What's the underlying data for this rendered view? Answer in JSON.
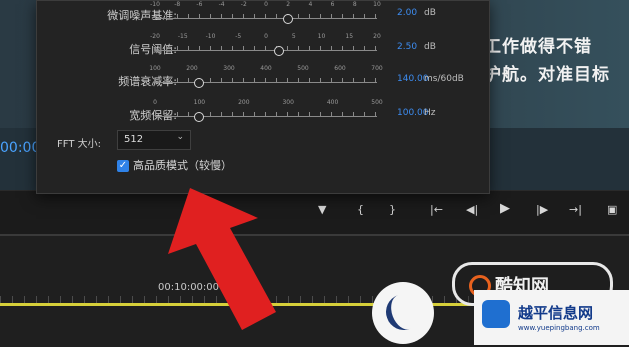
{
  "video": {
    "subtitle_line1": "工作做得不错",
    "subtitle_line2": "护航。对准目标",
    "timecode_left": "00:00"
  },
  "timeline": {
    "ruler_timecode": "00:10:00:00"
  },
  "popup": {
    "sliders": [
      {
        "label": "微调噪声基准:",
        "ticks": [
          "-10",
          "-8",
          "-6",
          "-4",
          "-2",
          "0",
          "2",
          "4",
          "6",
          "8",
          "10"
        ],
        "value": "2.00",
        "unit": "dB",
        "position_fraction": 0.6
      },
      {
        "label": "信号阈值:",
        "ticks": [
          "-20",
          "-15",
          "-10",
          "-5",
          "0",
          "5",
          "10",
          "15",
          "20"
        ],
        "value": "2.50",
        "unit": "dB",
        "position_fraction": 0.56
      },
      {
        "label": "频谱衰减率:",
        "ticks": [
          "100",
          "200",
          "300",
          "400",
          "500",
          "600",
          "700"
        ],
        "value": "140.00",
        "unit": "ms/60dB",
        "position_fraction": 0.2
      },
      {
        "label": "宽频保留:",
        "ticks": [
          "0",
          "100",
          "200",
          "300",
          "400",
          "500"
        ],
        "value": "100.00",
        "unit": "Hz",
        "position_fraction": 0.2
      }
    ],
    "fft_label": "FFT 大小:",
    "fft_value": "512",
    "hq_label": "高品质模式（较慢）",
    "hq_checked": true
  },
  "watermark": {
    "badge_text": "酷知网",
    "site_name": "越平信息网",
    "site_url": "www.yuepingbang.com"
  },
  "colors": {
    "accent": "#3d8cf0",
    "arrow": "#e02020",
    "playhead": "#d6cf3a"
  },
  "icons": {
    "checkbox": "check-icon",
    "fft_dropdown": "chevron-down-icon",
    "transport": [
      "marker-icon",
      "mark-in-icon",
      "mark-out-icon",
      "go-to-in-icon",
      "step-back-icon",
      "play-icon",
      "step-forward-icon",
      "go-to-out-icon",
      "export-frame-icon"
    ]
  }
}
